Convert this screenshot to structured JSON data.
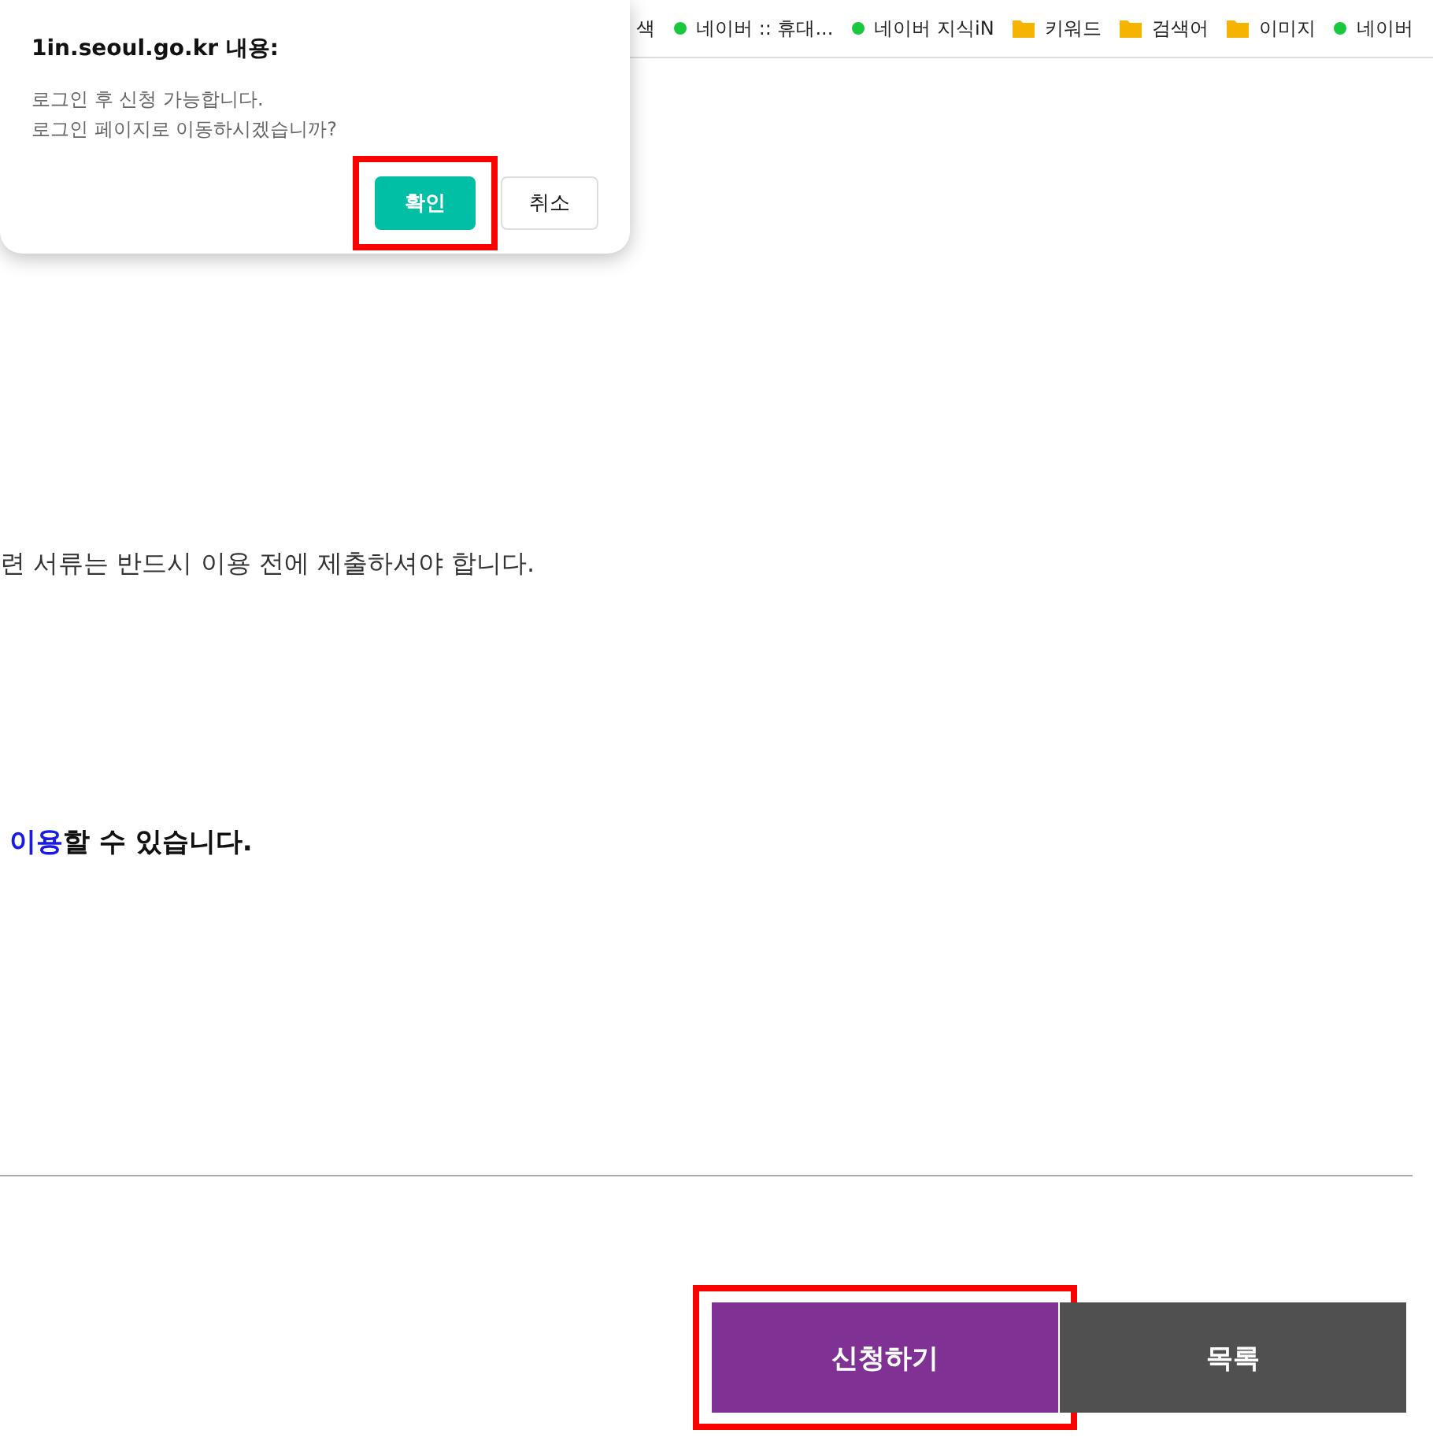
{
  "bookmarks_bar": {
    "items": [
      {
        "label": "색",
        "kind": "text"
      },
      {
        "label": "네이버 :: 휴대...",
        "kind": "site"
      },
      {
        "label": "네이버 지식iN",
        "kind": "site"
      },
      {
        "label": "키워드",
        "kind": "folder"
      },
      {
        "label": "검색어",
        "kind": "folder"
      },
      {
        "label": "이미지",
        "kind": "folder"
      },
      {
        "label": "네이버",
        "kind": "site"
      }
    ]
  },
  "notice": "련 서류는 반드시 이용 전에 제출하셔야 합니다.",
  "usage_line": {
    "segments": [
      {
        "text": "이용",
        "highlight": true
      },
      {
        "text": "할 수 있습니다.",
        "highlight": false
      }
    ]
  },
  "actions": [
    {
      "label": "신청하기",
      "kind": "primary",
      "highlighted": true
    },
    {
      "label": "목록",
      "kind": "secondary",
      "highlighted": false
    }
  ],
  "dialog": {
    "title": "1in.seoul.go.kr 내용:",
    "message": [
      "로그인 후 신청 가능합니다.",
      "로그인 페이지로 이동하시겠습니까?"
    ],
    "buttons": [
      {
        "label": "확인",
        "kind": "primary",
        "highlighted": true
      },
      {
        "label": "취소",
        "kind": "secondary",
        "highlighted": false
      }
    ]
  }
}
